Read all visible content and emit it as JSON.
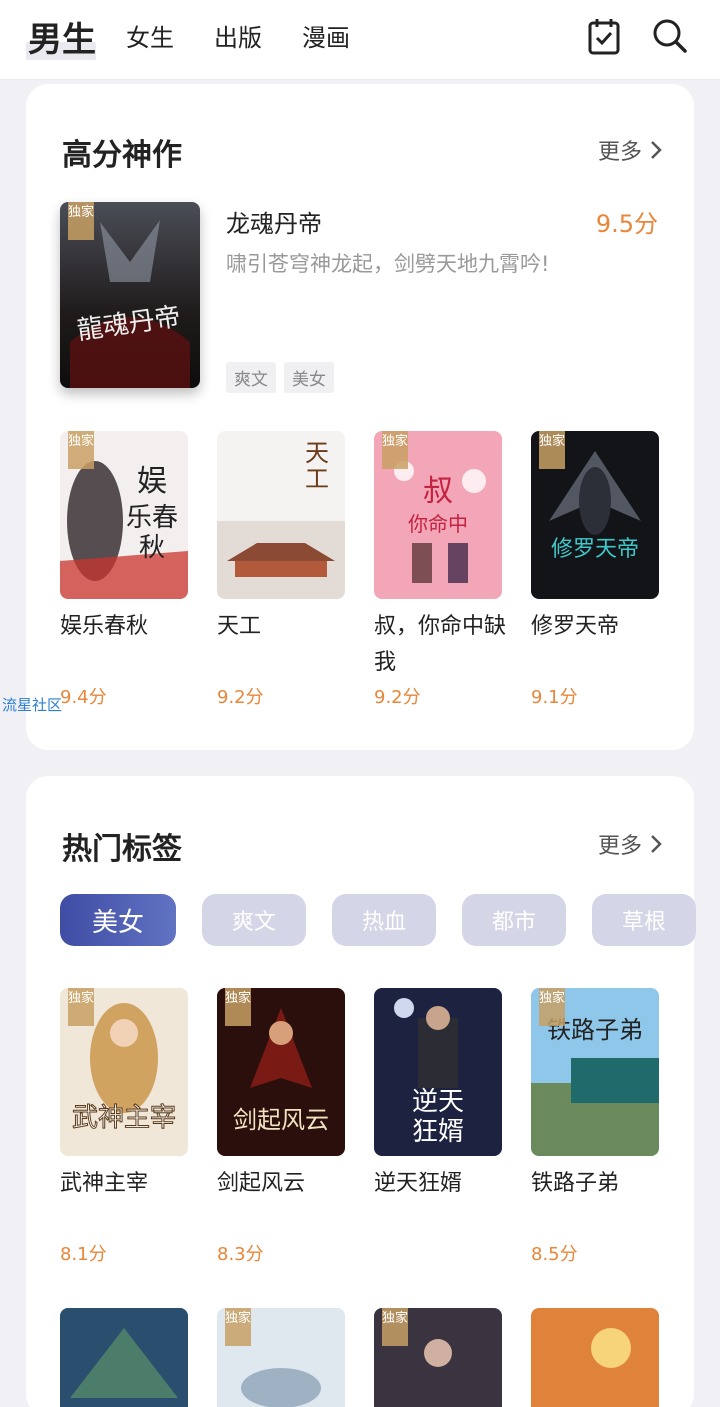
{
  "nav": {
    "tabs": [
      "男生",
      "女生",
      "出版",
      "漫画"
    ],
    "active_tab": "男生",
    "icons": [
      "checklist-icon",
      "search-icon"
    ]
  },
  "top_rated": {
    "title": "高分神作",
    "more": "更多",
    "featured": {
      "title": "龙魂丹帝",
      "score": "9.5分",
      "description": "啸引苍穹神龙起，剑劈天地九霄吟!",
      "tags": [
        "爽文",
        "美女"
      ],
      "badge": "独家"
    },
    "books": [
      {
        "title": "娱乐春秋",
        "score": "9.4分",
        "badge": "独家"
      },
      {
        "title": "天工",
        "score": "9.2分",
        "badge": ""
      },
      {
        "title": "叔，你命中缺我",
        "score": "9.2分",
        "badge": "独家"
      },
      {
        "title": "修罗天帝",
        "score": "9.1分",
        "badge": "独家"
      }
    ]
  },
  "watermark": "流星社区",
  "hot_tags": {
    "title": "热门标签",
    "more": "更多",
    "chips": [
      "美女",
      "爽文",
      "热血",
      "都市",
      "草根"
    ],
    "active_chip": "美女",
    "books": [
      {
        "title": "武神主宰",
        "score": "8.1分",
        "badge": "独家"
      },
      {
        "title": "剑起风云",
        "score": "8.3分",
        "badge": "独家"
      },
      {
        "title": "逆天狂婿",
        "score": "",
        "badge": ""
      },
      {
        "title": "铁路子弟",
        "score": "8.5分",
        "badge": "独家"
      }
    ],
    "more_books_badges": [
      "",
      "独家",
      "独家",
      ""
    ]
  },
  "colors": {
    "score": "#e8863a",
    "chip_active": "#3f4ca4",
    "chip_inactive": "#d4d5e7"
  }
}
